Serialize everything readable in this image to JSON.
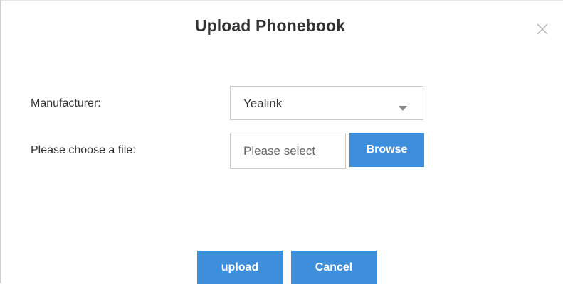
{
  "dialog": {
    "title": "Upload Phonebook",
    "close_icon": "close-icon"
  },
  "form": {
    "manufacturer_label": "Manufacturer:",
    "manufacturer_value": "Yealink",
    "file_label": "Please choose a file:",
    "file_placeholder": "Please select",
    "browse_label": "Browse"
  },
  "actions": {
    "upload_label": "upload",
    "cancel_label": "Cancel"
  },
  "colors": {
    "primary_button": "#3d8fdb",
    "text": "#333333",
    "border": "#cccccc"
  }
}
